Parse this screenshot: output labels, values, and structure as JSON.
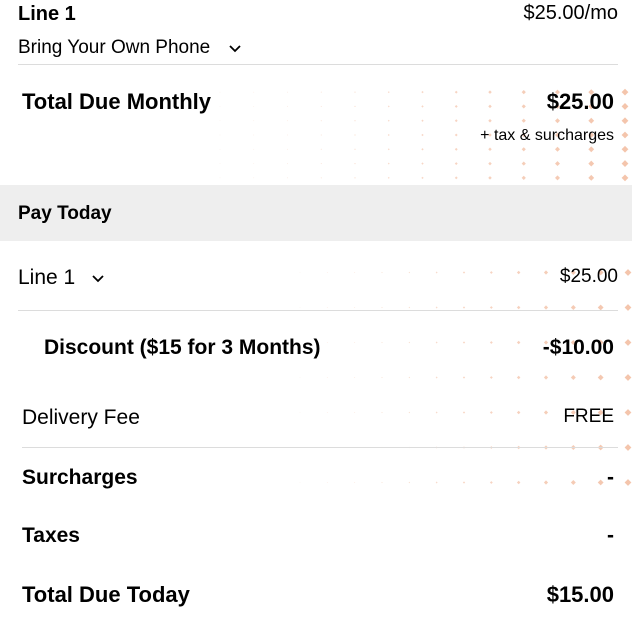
{
  "line_summary": {
    "line_label": "Line 1",
    "line_price": "$25.00/mo",
    "device_option": "Bring Your Own Phone"
  },
  "monthly": {
    "label": "Total Due Monthly",
    "amount": "$25.00",
    "note": "+ tax & surcharges"
  },
  "pay_today": {
    "heading": "Pay Today",
    "line_label": "Line 1",
    "line_amount": "$25.00",
    "discount_label": "Discount ($15 for 3 Months)",
    "discount_amount": "-$10.00",
    "delivery_label": "Delivery Fee",
    "delivery_amount": "FREE",
    "surcharges_label": "Surcharges",
    "surcharges_amount": "-",
    "taxes_label": "Taxes",
    "taxes_amount": "-",
    "total_label": "Total Due Today",
    "total_amount": "$15.00"
  },
  "colors": {
    "accent_dots": "#f3c2a8",
    "band": "#eeeeee",
    "divider": "#dcdcdc"
  },
  "icons": [
    "chevron-down-icon"
  ]
}
